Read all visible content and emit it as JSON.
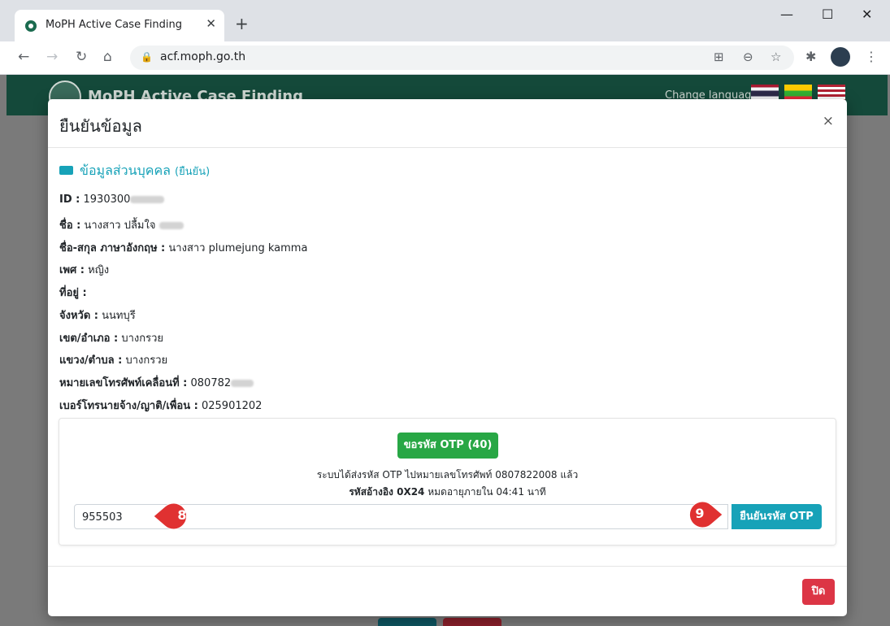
{
  "browser": {
    "tab_title": "MoPH Active Case Finding",
    "tab_close": "✕",
    "new_tab": "+",
    "url": "acf.moph.go.th",
    "window_controls": {
      "minimize": "—",
      "maximize": "☐",
      "close": "✕"
    },
    "nav": {
      "back": "←",
      "forward": "→",
      "reload": "↻",
      "home": "⌂"
    },
    "menu": "⋮"
  },
  "site": {
    "brand": "MoPH Active Case Finding",
    "change_language": "Change language"
  },
  "modal": {
    "title": "ยืนยันข้อมูล",
    "close": "×",
    "section_title": "ข้อมูลส่วนบุคคล",
    "section_sub": "(ยืนยัน)",
    "fields": [
      {
        "label": "ID :",
        "value": "1930300"
      },
      {
        "label": "ชื่อ :",
        "value": "นางสาว ปลื้มใจ"
      },
      {
        "label": "ชื่อ-สกุล ภาษาอังกฤษ :",
        "value": "นางสาว plumejung kamma"
      },
      {
        "label": "เพศ :",
        "value": "หญิง"
      },
      {
        "label": "ที่อยู่ :",
        "value": ""
      },
      {
        "label": "จังหวัด :",
        "value": "นนทบุรี"
      },
      {
        "label": "เขต/อำเภอ :",
        "value": "บางกรวย"
      },
      {
        "label": "แขวง/ตำบล :",
        "value": "บางกรวย"
      },
      {
        "label": "หมายเลขโทรศัพท์เคลื่อนที่ :",
        "value": "080782"
      },
      {
        "label": "เบอร์โทรนายจ้าง/ญาติ/เพื่อน :",
        "value": "025901202"
      }
    ],
    "otp": {
      "request_button": "ขอรหัส OTP (40)",
      "message_line1": "ระบบได้ส่งรหัส OTP ไปหมายเลขโทรศัพท์ 0807822008 แล้ว",
      "ref_label": "รหัสอ้างอิง 0X24",
      "ref_suffix": "หมดอายุภายใน 04:41  นาที",
      "input_value": "955503",
      "verify_button": "ยืนยันรหัส OTP"
    },
    "markers": {
      "input": "8",
      "verify": "9"
    },
    "close_button": "ปิด"
  },
  "colors": {
    "marker": "#e03131",
    "teal": "#17a2b8",
    "green": "#28a745",
    "danger": "#dc3545",
    "header": "#14493a"
  }
}
